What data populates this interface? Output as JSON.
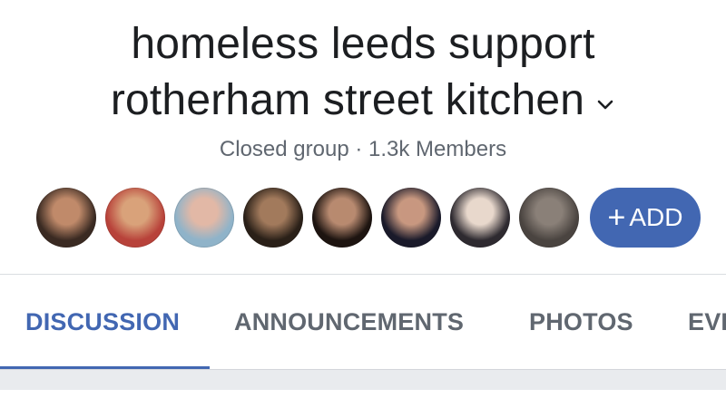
{
  "group": {
    "title_line1": "homeless leeds support",
    "title_line2": "rotherham street kitchen",
    "privacy": "Closed group",
    "separator": "·",
    "members_count": "1.3k Members"
  },
  "members": {
    "avatars": [
      {
        "name": "member-avatar-1",
        "colors": [
          "#3a2a22",
          "#c08a6a"
        ]
      },
      {
        "name": "member-avatar-2",
        "colors": [
          "#b8423a",
          "#d9a27a"
        ]
      },
      {
        "name": "member-avatar-3",
        "colors": [
          "#8fb3c9",
          "#e2b8a6"
        ]
      },
      {
        "name": "member-avatar-4",
        "colors": [
          "#2a2018",
          "#a27a5c"
        ]
      },
      {
        "name": "member-avatar-5",
        "colors": [
          "#1d1410",
          "#b88a70"
        ]
      },
      {
        "name": "member-avatar-6",
        "colors": [
          "#1a1a2a",
          "#c89880"
        ]
      },
      {
        "name": "member-avatar-7",
        "colors": [
          "#2e2a30",
          "#e8d8cc"
        ]
      },
      {
        "name": "member-avatar-8",
        "colors": [
          "#4a4440",
          "#8a8078"
        ]
      }
    ],
    "add_label": "ADD",
    "add_symbol": "+"
  },
  "tabs": [
    {
      "label": "DISCUSSION",
      "active": true
    },
    {
      "label": "ANNOUNCEMENTS",
      "active": false
    },
    {
      "label": "PHOTOS",
      "active": false
    },
    {
      "label": "EVENTS",
      "active": false
    }
  ],
  "colors": {
    "accent": "#4267b2",
    "text_primary": "#1c1e21",
    "text_secondary": "#606770"
  }
}
